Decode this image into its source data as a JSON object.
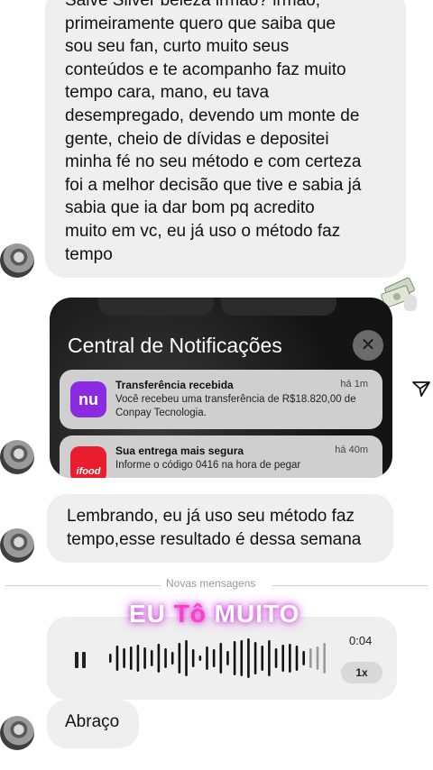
{
  "messages": {
    "first": "Salve Silver beleza irmão? irmão,\nprimeiramente quero que saiba que\nsou seu fan, curto muito seus\nconteúdos e te acompanho faz muito\ntempo cara, mano, eu tava\ndesempregado, devendo um monte de\ngente, cheio de dívidas e depositei\nminha fé no seu método e com certeza\nfoi a melhor decisão que tive e sabia já\nsabia que ia dar bom pq acredito\nmuito em vc, eu já uso o método faz\ntempo",
    "second": "Lembrando, eu já uso seu método faz\ntempo,esse resultado é dessa semana",
    "third": "Abraço"
  },
  "notification_card": {
    "title": "Central de Notificações",
    "close_glyph": "✕",
    "items": [
      {
        "app_icon_text": "nu",
        "title": "Transferência recebida",
        "time": "há 1m",
        "body": "Você recebeu uma transferência de R$18.820,00 de Conpay Tecnologia."
      },
      {
        "app_icon_text": "ifood",
        "title": "Sua entrega mais segura",
        "time": "há 40m",
        "body": "Informe o código 0416 na hora de pegar"
      }
    ]
  },
  "divider": {
    "label": "Novas mensagens"
  },
  "caption": {
    "part1": "EU ",
    "part2": "Tô",
    "part3": " MUITO"
  },
  "audio": {
    "duration": "0:04",
    "speed": "1x",
    "bars": [
      10,
      28,
      22,
      26,
      30,
      24,
      18,
      32,
      22,
      14,
      34,
      40,
      20,
      6,
      26,
      20,
      34,
      16,
      38,
      40,
      44,
      36,
      28,
      40,
      22,
      30,
      32,
      28,
      16,
      22,
      26,
      34
    ]
  },
  "colors": {
    "bubble": "#efefef",
    "nubank": "#8a2be2",
    "ifood": "#ea1d2c",
    "caption_glow": "#c93fd8",
    "caption_pink": "#ff3ec5"
  },
  "icons": [
    "avatar",
    "money-stack-icon",
    "close-icon",
    "send-icon",
    "pause-icon",
    "waveform"
  ]
}
